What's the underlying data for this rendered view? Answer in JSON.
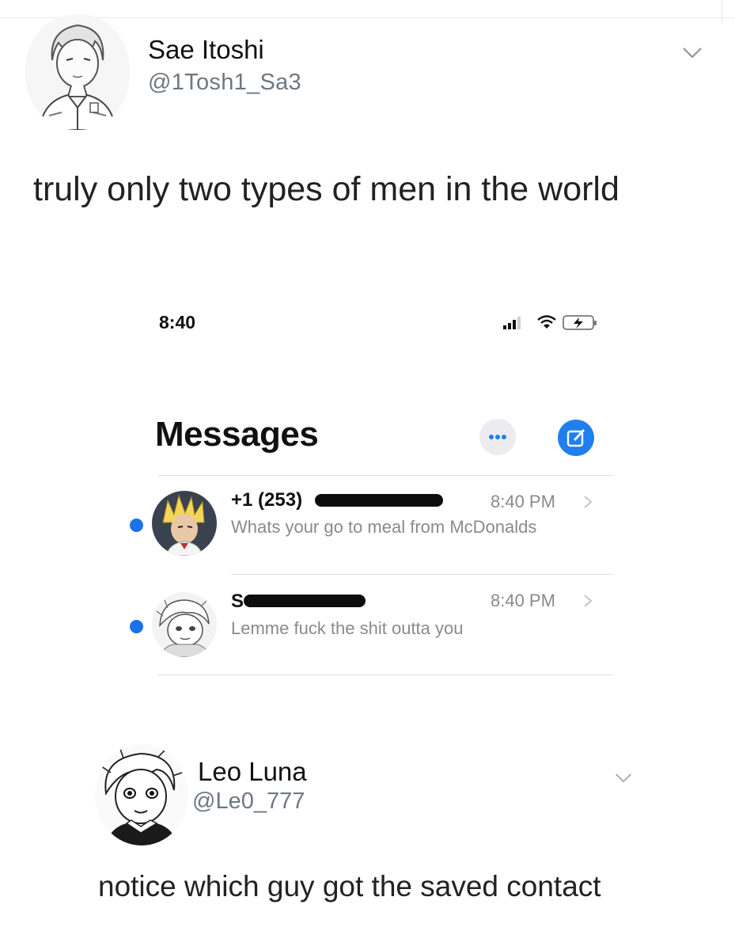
{
  "tweet1": {
    "name": "Sae Itoshi",
    "handle": "@1Tosh1_Sa3",
    "text": "truly only two types of men in the world",
    "avatar_icon": "anime-boy-avatar-icon",
    "menu_icon": "chevron-down-icon"
  },
  "phone": {
    "status_time": "8:40",
    "status_icons": [
      "signal-icon",
      "wifi-icon",
      "battery-charging-icon"
    ],
    "title": "Messages",
    "more_icon": "ellipsis-icon",
    "compose_icon": "compose-icon",
    "accent_color": "#1f7ff0",
    "unread_color": "#1a73e8",
    "conversations": [
      {
        "name": "+1 (253)",
        "name_redacted": true,
        "time": "8:40 PM",
        "preview": "Whats your go to meal from McDonalds",
        "unread": true,
        "avatar_icon": "spiky-hair-avatar-icon"
      },
      {
        "name": "S",
        "name_redacted": true,
        "time": "8:40 PM",
        "preview": "Lemme fuck the shit outta you",
        "unread": true,
        "avatar_icon": "manga-face-avatar-icon"
      }
    ]
  },
  "tweet2": {
    "name": "Leo Luna",
    "handle": "@Le0_777",
    "text": "notice which guy got the saved contact",
    "avatar_icon": "manga-boy-avatar-icon",
    "menu_icon": "chevron-down-icon"
  }
}
